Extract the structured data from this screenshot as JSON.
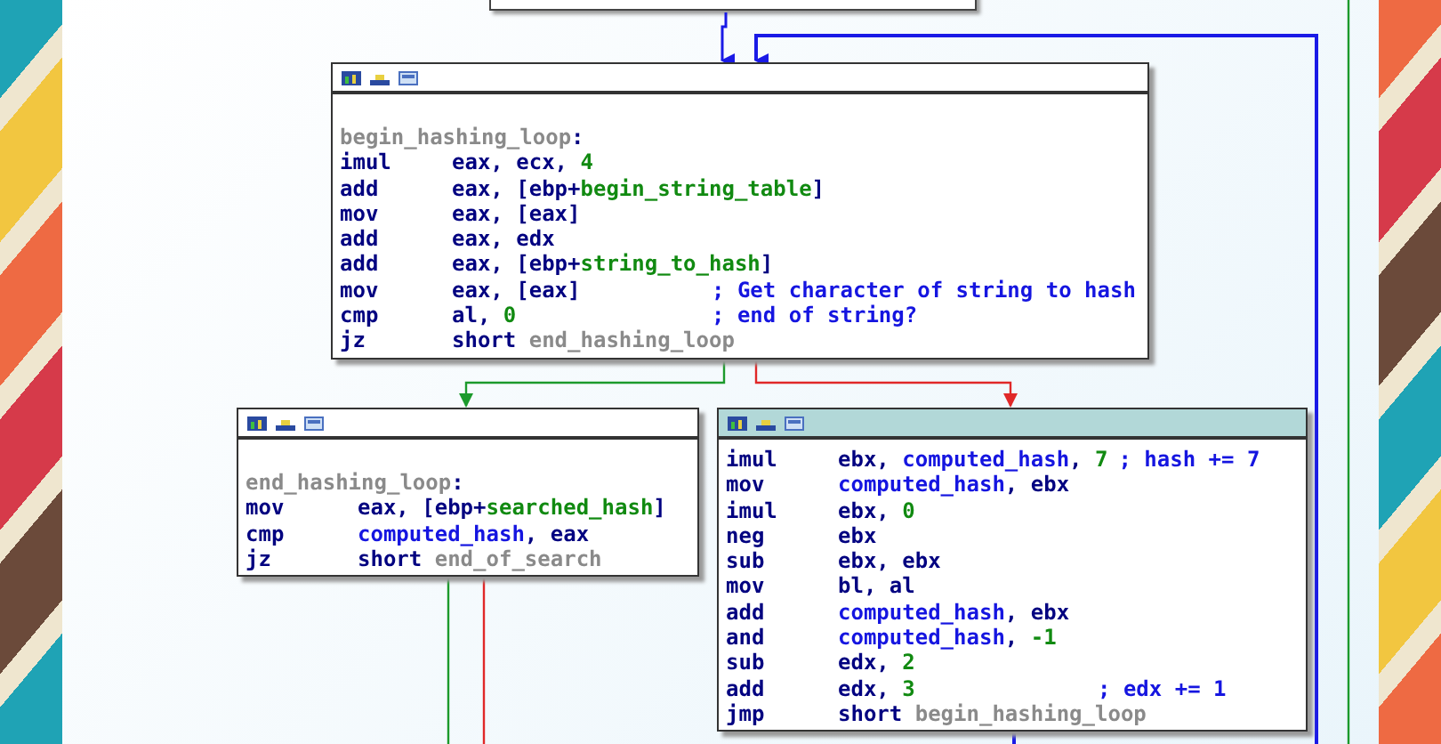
{
  "blocks": [
    {
      "selected": false,
      "lines": [
        {
          "kind": "label",
          "segments": [
            {
              "text": "begin_hashing_loop",
              "kind": "label"
            },
            {
              "text": ":",
              "kind": "plain"
            }
          ]
        },
        {
          "kind": "instruction",
          "mnemonic": "imul",
          "operands": [
            {
              "text": "eax, ecx, ",
              "kind": "plain"
            },
            {
              "text": "4",
              "kind": "number"
            }
          ]
        },
        {
          "kind": "instruction",
          "mnemonic": "add",
          "operands": [
            {
              "text": "eax, [ebp+",
              "kind": "plain"
            },
            {
              "text": "begin_string_table",
              "kind": "var"
            },
            {
              "text": "]",
              "kind": "plain"
            }
          ]
        },
        {
          "kind": "instruction",
          "mnemonic": "mov",
          "operands": [
            {
              "text": "eax, [eax]",
              "kind": "plain"
            }
          ]
        },
        {
          "kind": "instruction",
          "mnemonic": "add",
          "operands": [
            {
              "text": "eax, edx",
              "kind": "plain"
            }
          ]
        },
        {
          "kind": "instruction",
          "mnemonic": "add",
          "operands": [
            {
              "text": "eax, [ebp+",
              "kind": "plain"
            },
            {
              "text": "string_to_hash",
              "kind": "var"
            },
            {
              "text": "]",
              "kind": "plain"
            }
          ]
        },
        {
          "kind": "instruction",
          "mnemonic": "mov",
          "operands": [
            {
              "text": "eax, [eax]",
              "kind": "plain"
            }
          ],
          "comment": "; Get character of string to hash"
        },
        {
          "kind": "instruction",
          "mnemonic": "cmp",
          "operands": [
            {
              "text": "al, ",
              "kind": "plain"
            },
            {
              "text": "0",
              "kind": "number"
            }
          ],
          "comment": "; end of string?"
        },
        {
          "kind": "instruction",
          "mnemonic": "jz",
          "operands": [
            {
              "text": "short ",
              "kind": "plain"
            },
            {
              "text": "end_hashing_loop",
              "kind": "label"
            }
          ]
        }
      ]
    },
    {
      "selected": false,
      "lines": [
        {
          "kind": "label",
          "segments": [
            {
              "text": "end_hashing_loop",
              "kind": "label"
            },
            {
              "text": ":",
              "kind": "plain"
            }
          ]
        },
        {
          "kind": "instruction",
          "mnemonic": "mov",
          "operands": [
            {
              "text": "eax, [ebp+",
              "kind": "plain"
            },
            {
              "text": "searched_hash",
              "kind": "var"
            },
            {
              "text": "]",
              "kind": "plain"
            }
          ]
        },
        {
          "kind": "instruction",
          "mnemonic": "cmp",
          "operands": [
            {
              "text": "computed_hash",
              "kind": "name"
            },
            {
              "text": ", eax",
              "kind": "plain"
            }
          ]
        },
        {
          "kind": "instruction",
          "mnemonic": "jz",
          "operands": [
            {
              "text": "short ",
              "kind": "plain"
            },
            {
              "text": "end_of_search",
              "kind": "label"
            }
          ]
        }
      ]
    },
    {
      "selected": true,
      "lines": [
        {
          "kind": "instruction",
          "mnemonic": "imul",
          "operands": [
            {
              "text": "ebx, ",
              "kind": "plain"
            },
            {
              "text": "computed_hash",
              "kind": "name"
            },
            {
              "text": ", ",
              "kind": "plain"
            },
            {
              "text": "7",
              "kind": "number"
            }
          ],
          "comment": "; hash += 7"
        },
        {
          "kind": "instruction",
          "mnemonic": "mov",
          "operands": [
            {
              "text": "computed_hash",
              "kind": "name"
            },
            {
              "text": ", ebx",
              "kind": "plain"
            }
          ]
        },
        {
          "kind": "instruction",
          "mnemonic": "imul",
          "operands": [
            {
              "text": "ebx, ",
              "kind": "plain"
            },
            {
              "text": "0",
              "kind": "number"
            }
          ]
        },
        {
          "kind": "instruction",
          "mnemonic": "neg",
          "operands": [
            {
              "text": "ebx",
              "kind": "plain"
            }
          ]
        },
        {
          "kind": "instruction",
          "mnemonic": "sub",
          "operands": [
            {
              "text": "ebx, ebx",
              "kind": "plain"
            }
          ]
        },
        {
          "kind": "instruction",
          "mnemonic": "mov",
          "operands": [
            {
              "text": "bl, al",
              "kind": "plain"
            }
          ]
        },
        {
          "kind": "instruction",
          "mnemonic": "add",
          "operands": [
            {
              "text": "computed_hash",
              "kind": "name"
            },
            {
              "text": ", ebx",
              "kind": "plain"
            }
          ]
        },
        {
          "kind": "instruction",
          "mnemonic": "and",
          "operands": [
            {
              "text": "computed_hash",
              "kind": "name"
            },
            {
              "text": ", ",
              "kind": "plain"
            },
            {
              "text": "-1",
              "kind": "number"
            }
          ]
        },
        {
          "kind": "instruction",
          "mnemonic": "sub",
          "operands": [
            {
              "text": "edx, ",
              "kind": "plain"
            },
            {
              "text": "2",
              "kind": "number"
            }
          ]
        },
        {
          "kind": "instruction",
          "mnemonic": "add",
          "operands": [
            {
              "text": "edx, ",
              "kind": "plain"
            },
            {
              "text": "3",
              "kind": "number"
            }
          ],
          "comment": "; edx += 1"
        },
        {
          "kind": "instruction",
          "mnemonic": "jmp",
          "operands": [
            {
              "text": "short ",
              "kind": "plain"
            },
            {
              "text": "begin_hashing_loop",
              "kind": "label"
            }
          ]
        }
      ]
    }
  ]
}
